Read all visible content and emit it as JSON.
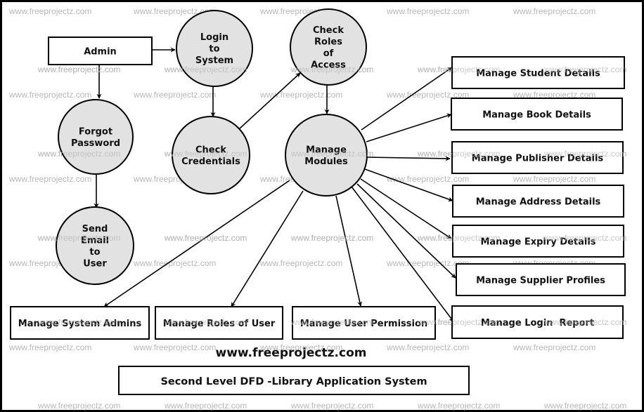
{
  "colors": {
    "process_fill": "#e2e2e2",
    "stroke": "#000000",
    "watermark": "#b8b8b8",
    "background": "#ffffff"
  },
  "watermark_text": "www.freeprojectz.com",
  "site_label": "www.freeprojectz.com",
  "diagram_title": "Second Level DFD -Library Application System",
  "entities": [
    {
      "id": "admin",
      "label": "Admin"
    }
  ],
  "processes": [
    {
      "id": "login",
      "lines": [
        "Login",
        "to",
        "System"
      ]
    },
    {
      "id": "roles",
      "lines": [
        "Check",
        "Roles",
        "of",
        "Access"
      ]
    },
    {
      "id": "forgot",
      "lines": [
        "Forgot",
        "Password"
      ]
    },
    {
      "id": "cred",
      "lines": [
        "Check",
        "Credentials"
      ]
    },
    {
      "id": "modules",
      "lines": [
        "Manage",
        "Modules"
      ]
    },
    {
      "id": "email",
      "lines": [
        "Send",
        "Email",
        "to",
        "User"
      ]
    }
  ],
  "modules": [
    {
      "id": "student",
      "label": "Manage Student Details"
    },
    {
      "id": "book",
      "label": "Manage Book Details"
    },
    {
      "id": "publisher",
      "label": "Manage Publisher Details"
    },
    {
      "id": "address",
      "label": "Manage Address Details"
    },
    {
      "id": "expiry",
      "label": "Manage Expiry Details"
    },
    {
      "id": "supplier",
      "label": "Manage Supplier Profiles"
    },
    {
      "id": "loginreport",
      "label": "Manage Login  Report"
    },
    {
      "id": "sysadmins",
      "label": "Manage System Admins"
    },
    {
      "id": "rolesuser",
      "label": "Manage Roles of User"
    },
    {
      "id": "userperm",
      "label": "Manage User Permission"
    }
  ],
  "flows": [
    {
      "from": "admin",
      "to": "login"
    },
    {
      "from": "admin",
      "to": "forgot"
    },
    {
      "from": "login",
      "to": "cred"
    },
    {
      "from": "cred",
      "to": "roles"
    },
    {
      "from": "roles",
      "to": "modules"
    },
    {
      "from": "forgot",
      "to": "email"
    },
    {
      "from": "modules",
      "to": "student"
    },
    {
      "from": "modules",
      "to": "book"
    },
    {
      "from": "modules",
      "to": "publisher"
    },
    {
      "from": "modules",
      "to": "address"
    },
    {
      "from": "modules",
      "to": "expiry"
    },
    {
      "from": "modules",
      "to": "supplier"
    },
    {
      "from": "modules",
      "to": "loginreport"
    },
    {
      "from": "modules",
      "to": "sysadmins"
    },
    {
      "from": "modules",
      "to": "rolesuser"
    },
    {
      "from": "modules",
      "to": "userperm"
    }
  ]
}
